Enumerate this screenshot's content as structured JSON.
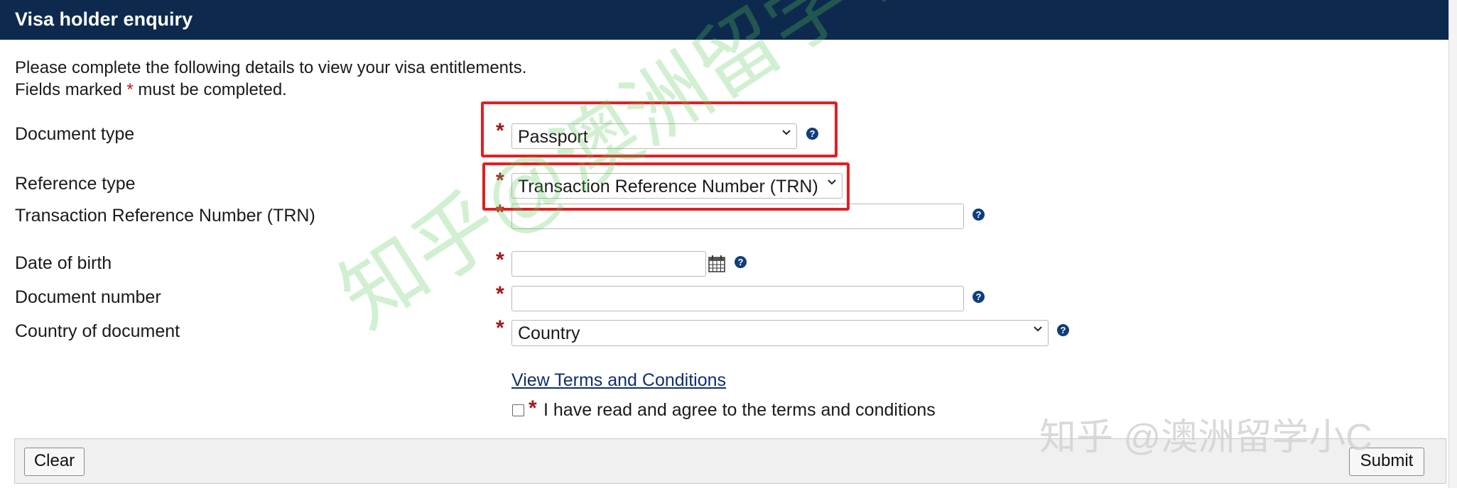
{
  "header": {
    "title": "Visa holder enquiry"
  },
  "intro": {
    "line1": "Please complete the following details to view your visa entitlements.",
    "line2_prefix": "Fields marked ",
    "required_marker": "*",
    "line2_suffix": " must be completed."
  },
  "form": {
    "document_type": {
      "label": "Document type",
      "value": "Passport"
    },
    "reference_type": {
      "label": "Reference type",
      "value": "Transaction Reference Number (TRN)"
    },
    "trn": {
      "label": "Transaction Reference Number (TRN)",
      "value": ""
    },
    "date_of_birth": {
      "label": "Date of birth",
      "value": ""
    },
    "document_number": {
      "label": "Document number",
      "value": ""
    },
    "country": {
      "label": "Country of document",
      "value": "Country"
    },
    "terms_link": "View Terms and Conditions",
    "terms_checkbox_label": "I have read and agree to the terms and conditions",
    "terms_checked": false
  },
  "buttons": {
    "clear": "Clear",
    "submit": "Submit"
  },
  "icons": {
    "help": "help-icon",
    "calendar": "calendar-icon",
    "dropdown": "chevron-down-icon"
  },
  "markers": {
    "required": "*",
    "help": "?"
  },
  "colors": {
    "header_bg": "#0d2a4e",
    "required": "#a01818",
    "highlight": "#e02020",
    "link": "#0f2f6b"
  },
  "watermark": {
    "diagonal": "知乎@澳洲留学小C",
    "corner": "知乎 @澳洲留学小C"
  }
}
